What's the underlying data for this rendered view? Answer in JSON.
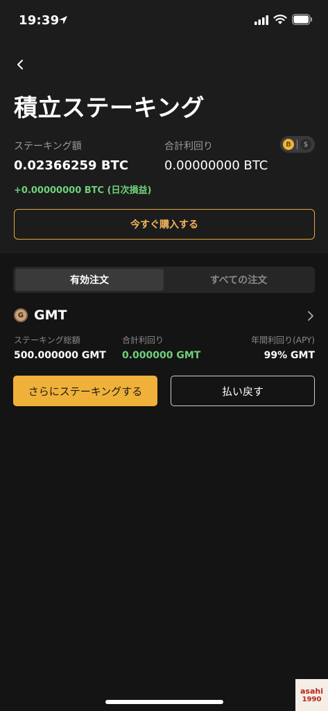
{
  "status_bar": {
    "time": "19:39"
  },
  "header": {
    "title": "積立ステーキング"
  },
  "summary": {
    "staking_label": "ステーキング額",
    "staking_value": "0.02366259 BTC",
    "total_label": "合計利回り",
    "total_value": "0.00000000 BTC",
    "daily_pl": "+0.00000000 BTC (日次損益)",
    "toggle": {
      "coin": "B",
      "fiat": "$"
    }
  },
  "buy_button": {
    "label": "今すぐ購入する"
  },
  "tabs": [
    {
      "label": "有効注文",
      "active": true
    },
    {
      "label": "すべての注文",
      "active": false
    }
  ],
  "order": {
    "coin_name": "GMT",
    "icon_glyph": "G",
    "columns": [
      {
        "label": "ステーキング総額",
        "value": "500.000000 GMT"
      },
      {
        "label": "合計利回り",
        "value": "0.000000 GMT"
      },
      {
        "label": "年間利回り(APY)",
        "value": "99% GMT"
      }
    ],
    "stake_more_label": "さらにステーキングする",
    "refund_label": "払い戻す"
  },
  "watermark": {
    "line1": "asahi",
    "line2": "1990"
  },
  "colors": {
    "accent": "#f0b13a",
    "positive": "#6fd07b",
    "background": "#141414",
    "panel": "#1c1c1c"
  }
}
